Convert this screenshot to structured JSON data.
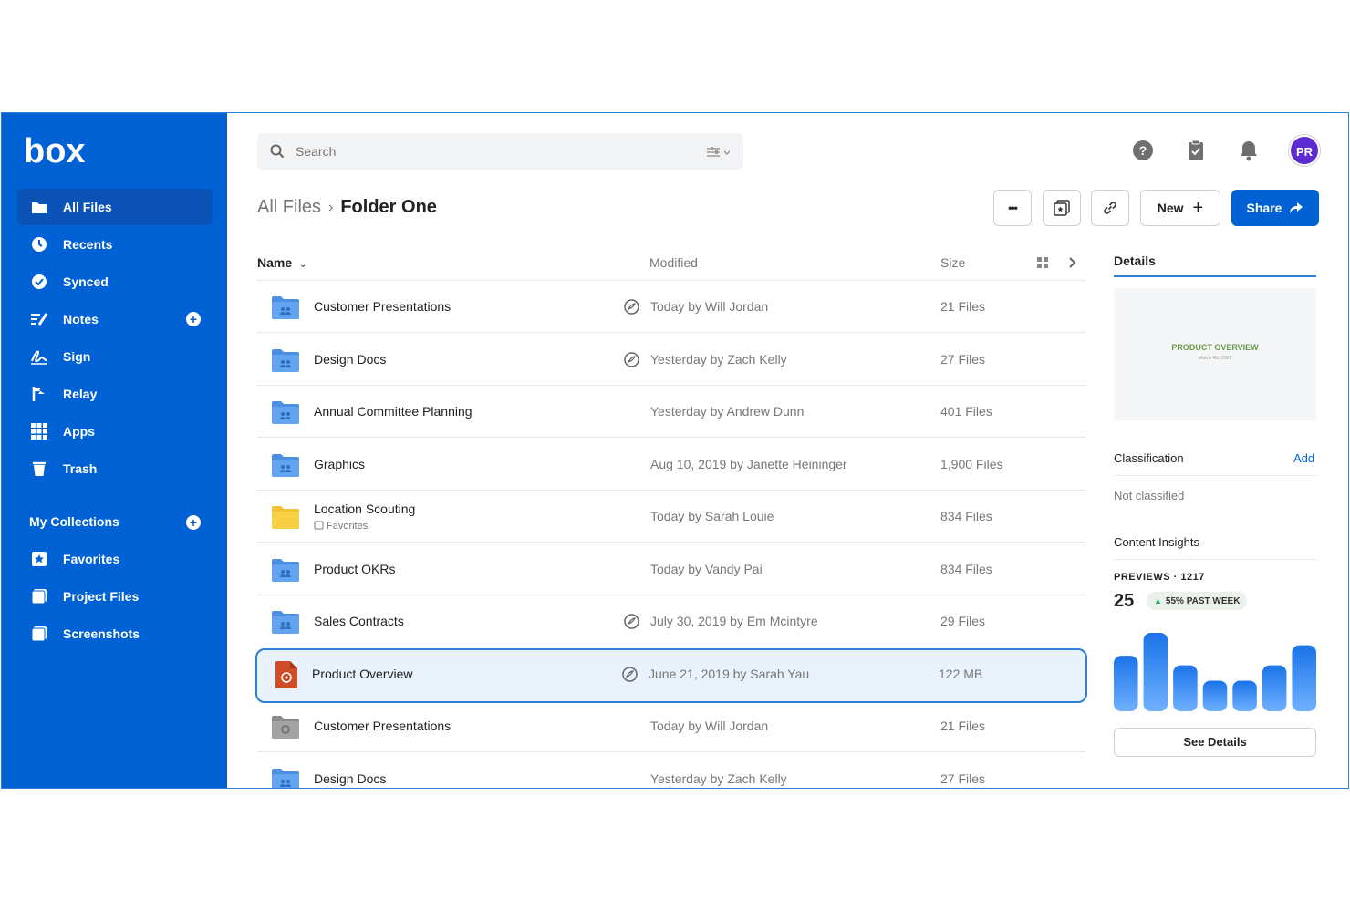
{
  "sidebar": {
    "logo_text": "box",
    "items": [
      {
        "label": "All Files",
        "icon": "folder-icon"
      },
      {
        "label": "Recents",
        "icon": "clock-icon"
      },
      {
        "label": "Synced",
        "icon": "check-circle-icon"
      },
      {
        "label": "Notes",
        "icon": "notes-icon"
      },
      {
        "label": "Sign",
        "icon": "signature-icon"
      },
      {
        "label": "Relay",
        "icon": "relay-icon"
      },
      {
        "label": "Apps",
        "icon": "grid-icon"
      },
      {
        "label": "Trash",
        "icon": "trash-icon"
      }
    ],
    "collections_title": "My Collections",
    "collections": [
      {
        "label": "Favorites",
        "icon": "star-collection-icon"
      },
      {
        "label": "Project Files",
        "icon": "collection-icon"
      },
      {
        "label": "Screenshots",
        "icon": "collection-icon"
      }
    ]
  },
  "search": {
    "placeholder": "Search"
  },
  "header": {
    "avatar_initials": "PR"
  },
  "breadcrumb": {
    "root": "All Files",
    "separator": "›",
    "current": "Folder One"
  },
  "actions": {
    "more": "•••",
    "new_label": "New",
    "share_label": "Share"
  },
  "table": {
    "columns": {
      "name": "Name",
      "modified": "Modified",
      "size": "Size"
    },
    "rows": [
      {
        "name": "Customer Presentations",
        "sub": "",
        "modified": "Today by Will Jordan",
        "size": "21 Files",
        "type": "shared-folder",
        "collab": true
      },
      {
        "name": "Design Docs",
        "sub": "",
        "modified": "Yesterday by Zach Kelly",
        "size": "27 Files",
        "type": "shared-folder",
        "collab": true
      },
      {
        "name": "Annual Committee Planning",
        "sub": "",
        "modified": "Yesterday by Andrew Dunn",
        "size": "401 Files",
        "type": "shared-folder",
        "collab": false
      },
      {
        "name": "Graphics",
        "sub": "",
        "modified": "Aug 10, 2019 by Janette Heininger",
        "size": "1,900 Files",
        "type": "shared-folder",
        "collab": false
      },
      {
        "name": "Location Scouting",
        "sub": "Favorites",
        "modified": "Today by Sarah Louie",
        "size": "834 Files",
        "type": "personal-folder",
        "collab": false
      },
      {
        "name": "Product OKRs",
        "sub": "",
        "modified": "Today by Vandy Pai",
        "size": "834 Files",
        "type": "shared-folder",
        "collab": false
      },
      {
        "name": "Sales Contracts",
        "sub": "",
        "modified": "July 30, 2019 by Em Mcintyre",
        "size": "29 Files",
        "type": "shared-folder",
        "collab": true
      },
      {
        "name": "Product Overview",
        "sub": "",
        "modified": "June 21, 2019 by Sarah Yau",
        "size": "122 MB",
        "type": "pdf-file",
        "collab": true
      },
      {
        "name": "Customer Presentations",
        "sub": "",
        "modified": "Today by Will Jordan",
        "size": "21 Files",
        "type": "external-folder",
        "collab": false
      },
      {
        "name": "Design Docs",
        "sub": "",
        "modified": "Yesterday by Zach Kelly",
        "size": "27 Files",
        "type": "shared-folder",
        "collab": false
      }
    ]
  },
  "details": {
    "tab": "Details",
    "preview_title": "PRODUCT OVERVIEW",
    "preview_sub": "March 4th, 2021",
    "classification_label": "Classification",
    "classification_add": "Add",
    "classification_value": "Not classified",
    "insights_title": "Content Insights",
    "previews_label": "PREVIEWS · 1217",
    "previews_week": "25",
    "trend_text": "55% PAST WEEK",
    "bar_values": [
      58,
      82,
      48,
      32,
      32,
      48,
      69
    ],
    "see_details": "See Details"
  },
  "colors": {
    "brand": "#0061d5",
    "selected_bg": "#e9f2fb",
    "folder_blue": "#4a90e2",
    "folder_yellow": "#f7d046",
    "pdf_red": "#d04b27",
    "trend_green": "#26a65b"
  }
}
